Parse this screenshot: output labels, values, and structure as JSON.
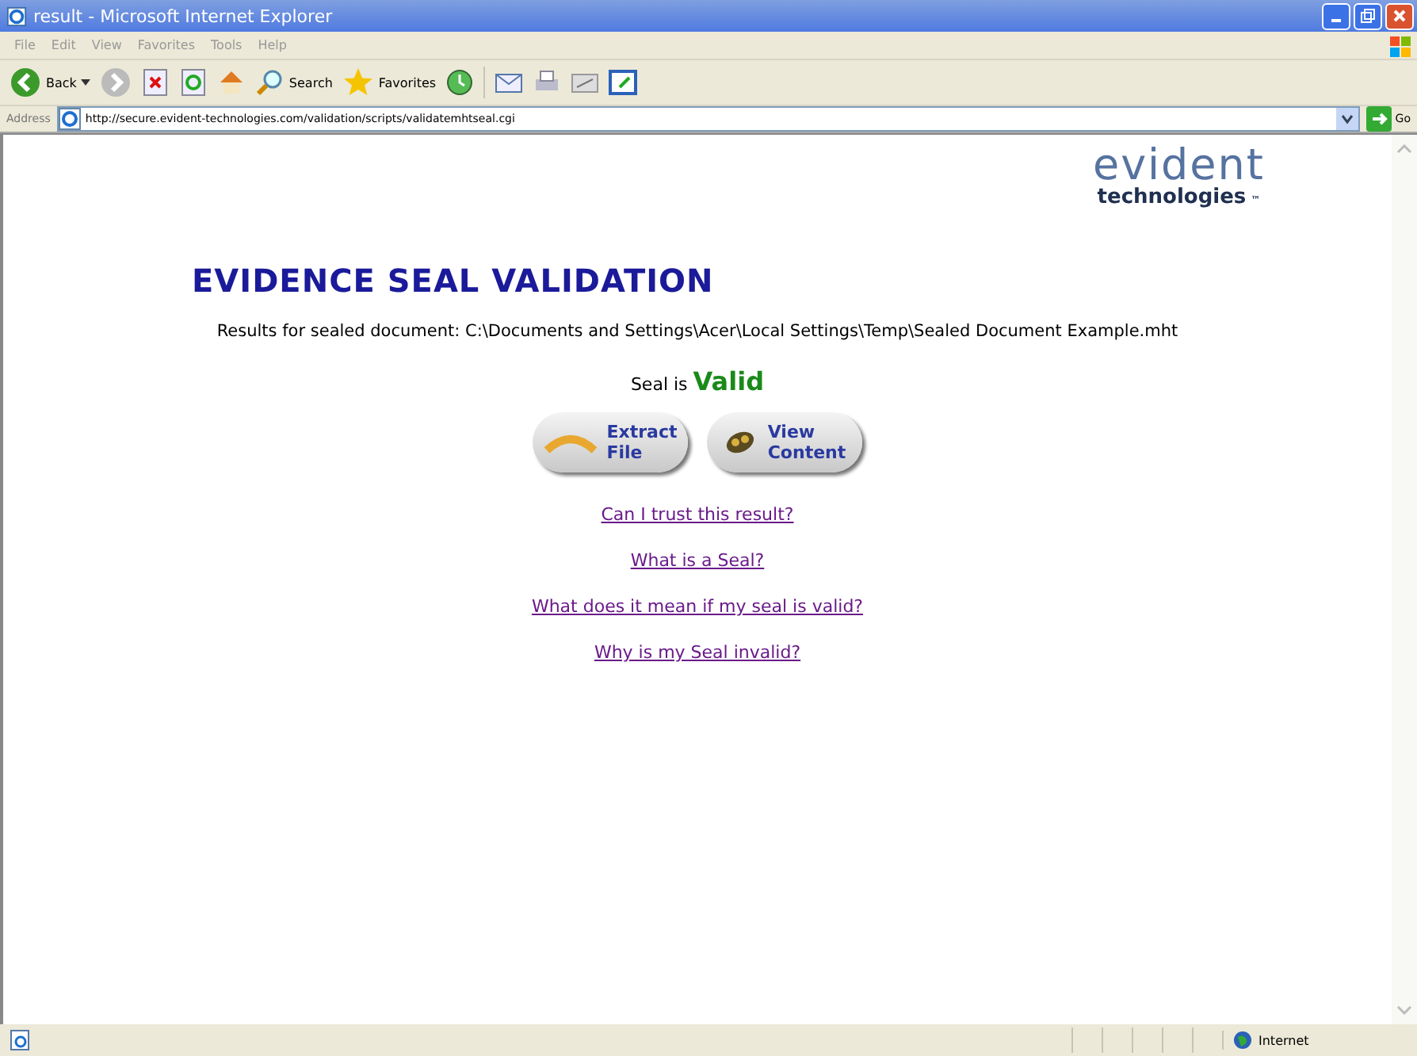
{
  "window": {
    "title": "result - Microsoft Internet Explorer"
  },
  "menu": [
    "File",
    "Edit",
    "View",
    "Favorites",
    "Tools",
    "Help"
  ],
  "toolbar": {
    "back": "Back",
    "search": "Search",
    "favorites": "Favorites"
  },
  "address": {
    "label": "Address",
    "url": "http://secure.evident-technologies.com/validation/scripts/validatemhtseal.cgi",
    "go": "Go"
  },
  "page": {
    "logo_top": "evident",
    "logo_bottom": "technologies",
    "logo_mark": "™",
    "heading": "EVIDENCE SEAL VALIDATION",
    "results": "Results for sealed document: C:\\Documents and Settings\\Acer\\Local Settings\\Temp\\Sealed Document Example.mht",
    "seal_label": "Seal is",
    "seal_status": "Valid",
    "buttons": [
      {
        "kind": "extract",
        "line1": "Extract",
        "line2": "File"
      },
      {
        "kind": "view",
        "line1": "View",
        "line2": "Content"
      }
    ],
    "links": [
      "Can I trust this result?",
      "What is a Seal?",
      "What does it mean if my seal is valid?",
      "Why is my Seal invalid?"
    ]
  },
  "status_bar": {
    "zone": "Internet"
  }
}
